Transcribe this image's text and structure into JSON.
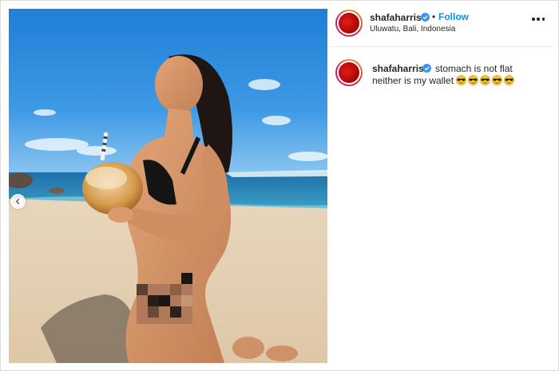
{
  "post": {
    "username": "shafaharris",
    "verified": true,
    "follow_separator": "•",
    "follow_label": "Follow",
    "location": "Uluwatu, Bali, Indonesia",
    "more_icon": "more-options-icon"
  },
  "caption": {
    "username": "shafaharris",
    "text": "stomach is not flat neither is my wallet",
    "emoji_name": "sunglasses-emoji",
    "emoji_count": 5
  },
  "photo": {
    "subject": "woman on beach holding coconut",
    "carousel_icon": "chevron-left-icon"
  },
  "colors": {
    "link": "#0095f6",
    "verified": "#3897f0",
    "text": "#262626",
    "border": "#dbdbdb"
  }
}
